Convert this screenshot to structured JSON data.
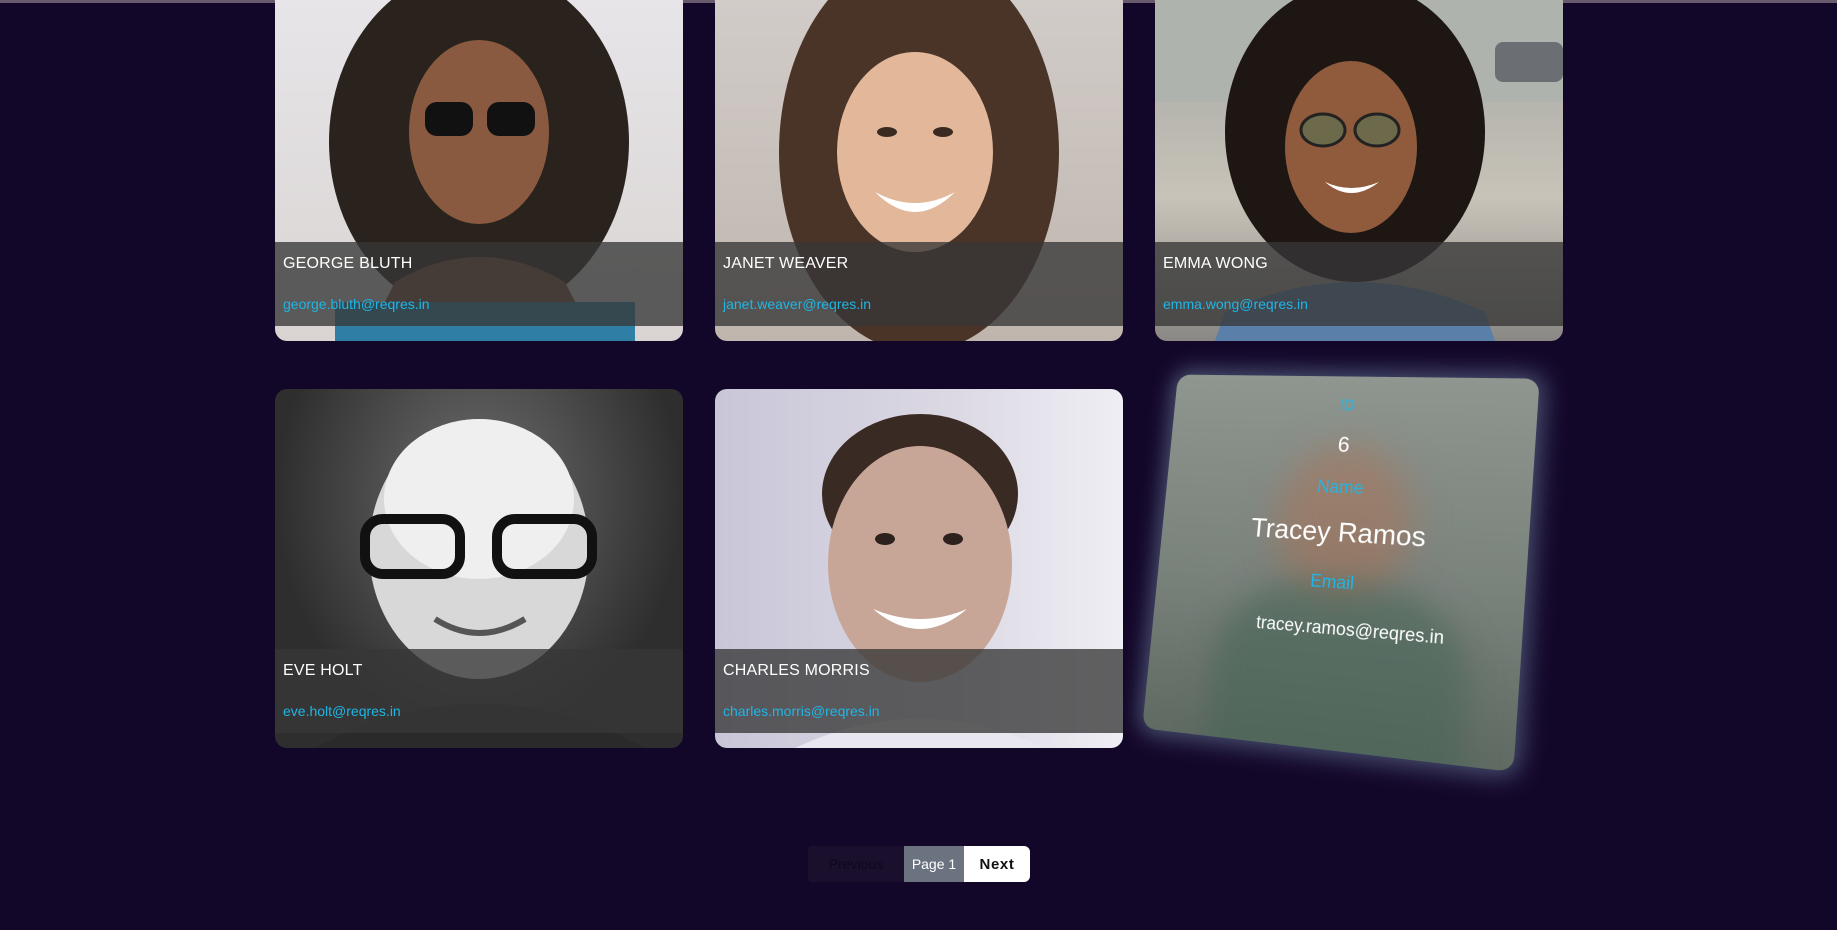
{
  "users": [
    {
      "name": "GEORGE BLUTH",
      "email": "george.bluth@reqres.in"
    },
    {
      "name": "JANET WEAVER",
      "email": "janet.weaver@reqres.in"
    },
    {
      "name": "EMMA WONG",
      "email": "emma.wong@reqres.in"
    },
    {
      "name": "EVE HOLT",
      "email": "eve.holt@reqres.in"
    },
    {
      "name": "CHARLES MORRIS",
      "email": "charles.morris@reqres.in"
    }
  ],
  "flipped_card": {
    "id_label": "ID",
    "id_value": "6",
    "name_label": "Name",
    "name_value": "Tracey Ramos",
    "email_label": "Email",
    "email_value": "tracey.ramos@reqres.in"
  },
  "pagination": {
    "previous_label": "Previous",
    "page_label": "Page 1",
    "next_label": "Next"
  },
  "colors": {
    "background": "#130729",
    "accent": "#1fb6e6"
  }
}
